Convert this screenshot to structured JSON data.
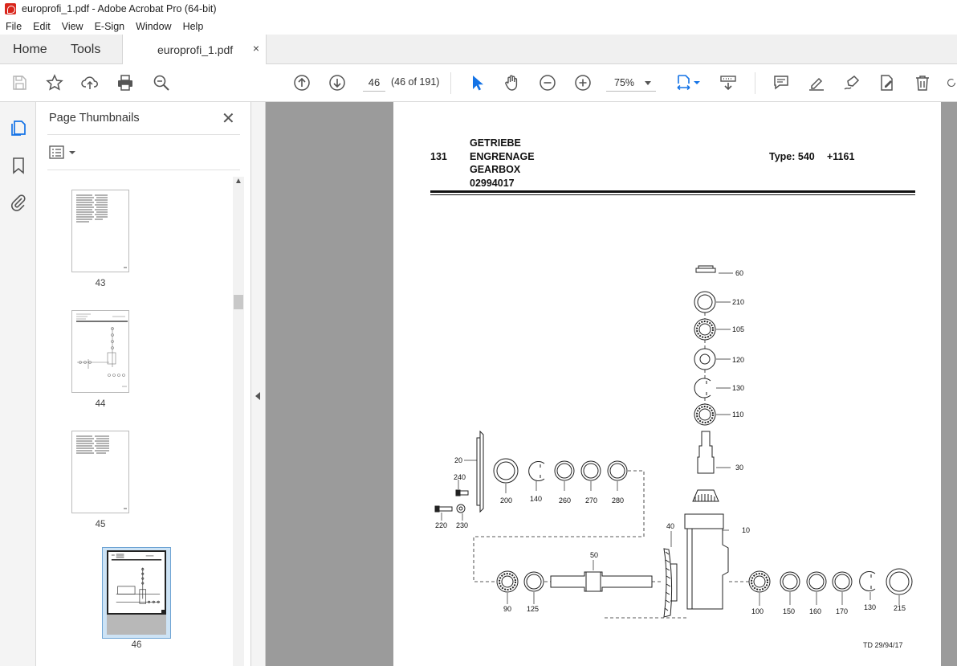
{
  "window": {
    "title": "europrofi_1.pdf - Adobe Acrobat Pro (64-bit)"
  },
  "menu": [
    "File",
    "Edit",
    "View",
    "E-Sign",
    "Window",
    "Help"
  ],
  "tabs": {
    "home": "Home",
    "tools": "Tools",
    "document": "europrofi_1.pdf",
    "close_glyph": "×"
  },
  "toolbar": {
    "page_current": "46",
    "page_count": "(46 of 191)",
    "zoom": "75%"
  },
  "panel": {
    "title": "Page Thumbnails",
    "close_glyph": "✕",
    "thumbnails": [
      {
        "label": "43"
      },
      {
        "label": "44"
      },
      {
        "label": "45"
      },
      {
        "label": "46",
        "selected": true
      }
    ]
  },
  "document_page": {
    "section_number": "131",
    "title_lines": [
      "GETRIEBE",
      "ENGRENAGE",
      "GEARBOX",
      "02994017"
    ],
    "type_label": "Type: 540",
    "type_code": "+1161",
    "footer": "TD 29/94/17",
    "callouts": {
      "p60": "60",
      "p210": "210",
      "p105": "105",
      "p120": "120",
      "p130a": "130",
      "p110": "110",
      "p30": "30",
      "p10": "10",
      "p40": "40",
      "p50": "50",
      "p20": "20",
      "p240": "240",
      "p200": "200",
      "p140": "140",
      "p260": "260",
      "p270": "270",
      "p280": "280",
      "p220": "220",
      "p230": "230",
      "p90": "90",
      "p125": "125",
      "p100": "100",
      "p150": "150",
      "p160": "160",
      "p170": "170",
      "p130b": "130",
      "p215": "215"
    }
  },
  "colors": {
    "accent_blue": "#1473e6",
    "viewer_bg": "#9b9b9b",
    "selection": "#cde3f5"
  }
}
